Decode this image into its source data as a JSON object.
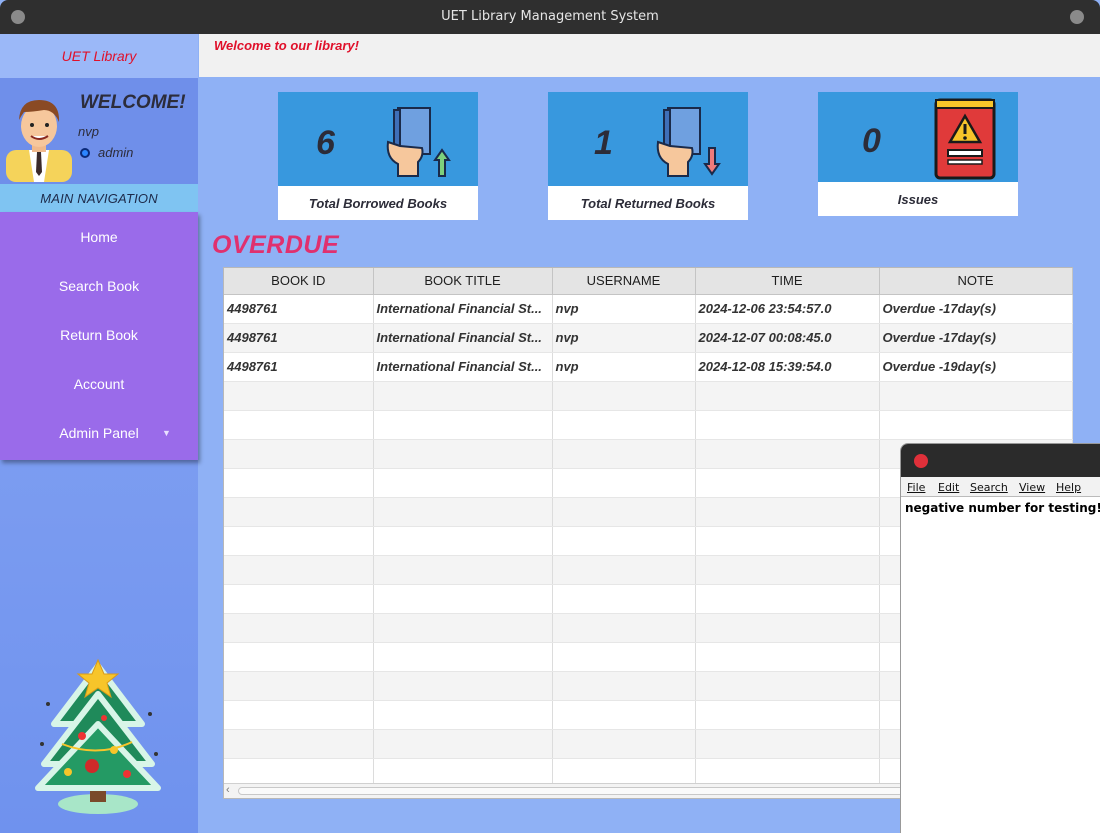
{
  "window": {
    "title": "UET Library Management System"
  },
  "sidebar": {
    "brand": "UET Library",
    "welcome": "WELCOME!",
    "username": "nvp",
    "role": "admin",
    "nav_header": "MAIN NAVIGATION",
    "items": [
      {
        "label": "Home"
      },
      {
        "label": "Search Book"
      },
      {
        "label": "Return Book"
      },
      {
        "label": "Account"
      },
      {
        "label": "Admin Panel"
      }
    ]
  },
  "header": {
    "welcome_text": "Welcome to our library!"
  },
  "cards": [
    {
      "value": "6",
      "label": "Total Borrowed Books",
      "icon": "borrow-book-icon"
    },
    {
      "value": "1",
      "label": "Total Returned Books",
      "icon": "return-book-icon"
    },
    {
      "value": "0",
      "label": "Issues",
      "icon": "warning-book-icon"
    }
  ],
  "section_title": "OVERDUE",
  "table": {
    "columns": [
      "BOOK ID",
      "BOOK TITLE",
      "USERNAME",
      "TIME",
      "NOTE"
    ],
    "rows": [
      [
        "4498761",
        "International Financial St...",
        "nvp",
        "2024-12-06 23:54:57.0",
        "Overdue -17day(s)"
      ],
      [
        "4498761",
        "International Financial St...",
        "nvp",
        "2024-12-07 00:08:45.0",
        "Overdue -17day(s)"
      ],
      [
        "4498761",
        "International Financial St...",
        "nvp",
        "2024-12-08 15:39:54.0",
        "Overdue -19day(s)"
      ]
    ]
  },
  "editor": {
    "menu": [
      "File",
      "Edit",
      "Search",
      "View",
      "Help"
    ],
    "text": "negative number for testing!"
  },
  "colors": {
    "accent_red": "#e0102a",
    "overdue_pink": "#e0306e",
    "card_blue": "#3898de",
    "nav_purple": "#9a6bea"
  }
}
